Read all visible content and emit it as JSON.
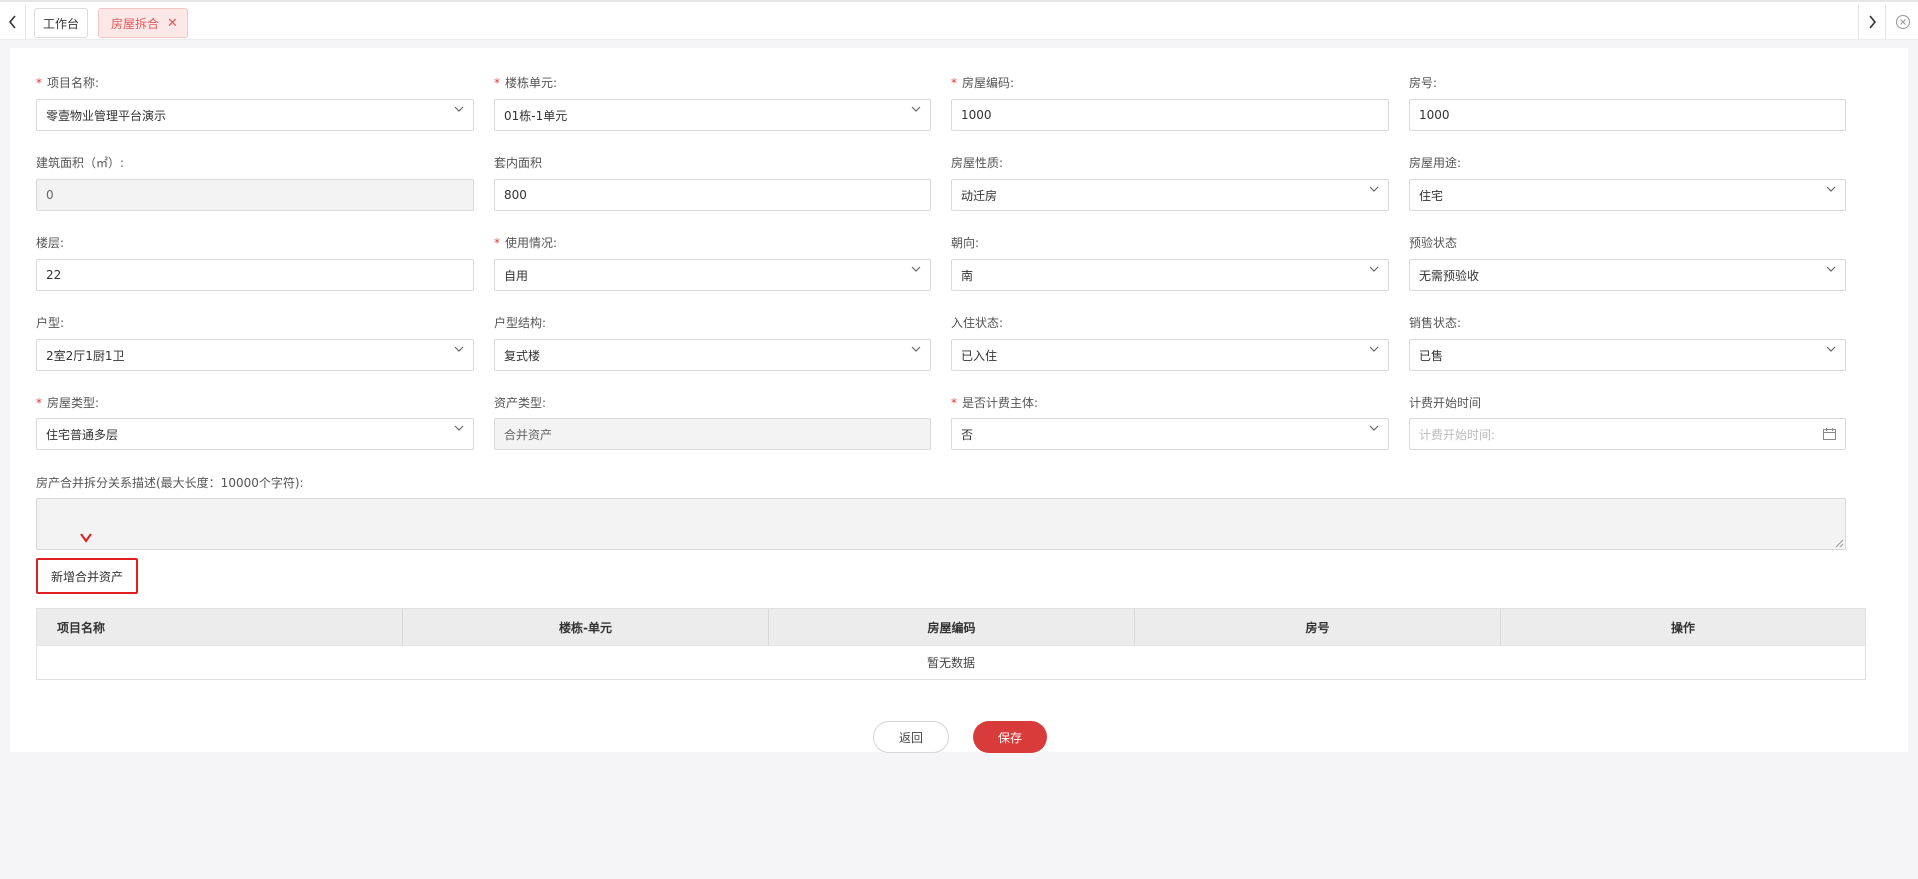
{
  "tabs": {
    "home_label": "工作台",
    "active_label": "房屋拆合",
    "close_glyph": "✕"
  },
  "form": {
    "project_name": {
      "label": "项目名称:",
      "required": true,
      "value": "零壹物业管理平台演示"
    },
    "building_unit": {
      "label": "楼栋单元:",
      "required": true,
      "value": "01栋-1单元"
    },
    "house_code": {
      "label": "房屋编码:",
      "required": true,
      "value": "1000"
    },
    "room_no": {
      "label": "房号:",
      "required": false,
      "value": "1000"
    },
    "build_area": {
      "label": "建筑面积（㎡）:",
      "required": false,
      "value": "0"
    },
    "inner_area": {
      "label": "套内面积",
      "required": false,
      "value": "800"
    },
    "house_nature": {
      "label": "房屋性质:",
      "required": false,
      "value": "动迁房"
    },
    "house_use": {
      "label": "房屋用途:",
      "required": false,
      "value": "住宅"
    },
    "floor": {
      "label": "楼层:",
      "required": false,
      "value": "22"
    },
    "usage": {
      "label": "使用情况:",
      "required": true,
      "value": "自用"
    },
    "orientation": {
      "label": "朝向:",
      "required": false,
      "value": "南"
    },
    "pre_check": {
      "label": "预验状态",
      "required": false,
      "value": "无需预验收"
    },
    "layout": {
      "label": "户型:",
      "required": false,
      "value": "2室2厅1厨1卫"
    },
    "structure": {
      "label": "户型结构:",
      "required": false,
      "value": "复式楼"
    },
    "occupancy": {
      "label": "入住状态:",
      "required": false,
      "value": "已入住"
    },
    "sales": {
      "label": "销售状态:",
      "required": false,
      "value": "已售"
    },
    "house_type": {
      "label": "房屋类型:",
      "required": true,
      "value": "住宅普通多层"
    },
    "asset_type": {
      "label": "资产类型:",
      "required": false,
      "value": "合并资产"
    },
    "billing_subject": {
      "label": "是否计费主体:",
      "required": true,
      "value": "否"
    },
    "billing_start": {
      "label": "计费开始时间",
      "required": false,
      "placeholder": "计费开始时间:"
    },
    "description": {
      "label": "房产合并拆分关系描述(最大长度：10000个字符):"
    }
  },
  "add_button_label": "新增合并资产",
  "table": {
    "columns": [
      "项目名称",
      "楼栋-单元",
      "房屋编码",
      "房号",
      "操作"
    ],
    "empty_text": "暂无数据"
  },
  "actions": {
    "back_label": "返回",
    "save_label": "保存"
  },
  "colors": {
    "accent": "#d93a3a",
    "required": "#e03b3b",
    "tab_active_bg": "#fde8e8"
  }
}
